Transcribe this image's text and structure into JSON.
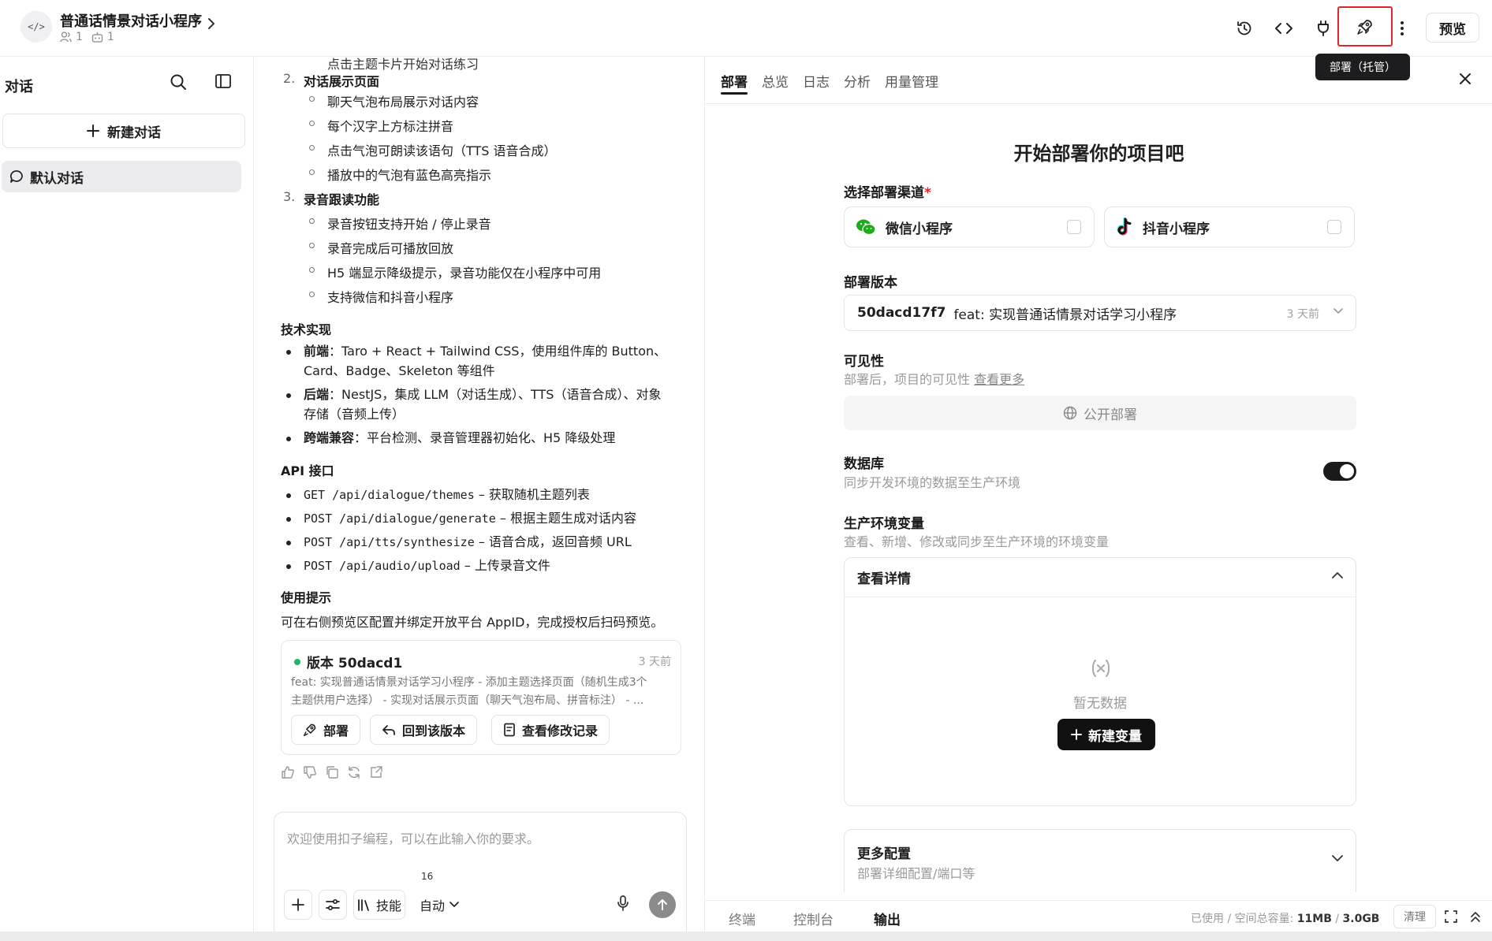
{
  "topbar": {
    "project_icon_text": "</>",
    "project_title": "普通话情景对话小程序",
    "members": "1",
    "bots": "1",
    "deploy_tooltip": "部署（托管）",
    "preview_label": "预览"
  },
  "sidebar": {
    "title": "对话",
    "new_chat_label": "新建对话",
    "items": [
      {
        "label": "默认对话"
      }
    ]
  },
  "chat": {
    "clipped_text": "点击主题卡片开始对话练习",
    "sections": [
      {
        "num": "2.",
        "title": "对话展示页面",
        "items": [
          "聊天气泡布局展示对话内容",
          "每个汉字上方标注拼音",
          "点击气泡可朗读该语句（TTS 语音合成）",
          "播放中的气泡有蓝色高亮指示"
        ]
      },
      {
        "num": "3.",
        "title": "录音跟读功能",
        "items": [
          "录音按钮支持开始 / 停止录音",
          "录音完成后可播放回放",
          "H5 端显示降级提示，录音功能仅在小程序中可用",
          "支持微信和抖音小程序"
        ]
      }
    ],
    "tech_heading": "技术实现",
    "tech": [
      {
        "label": "前端",
        "line1": "：Taro + React + Tailwind CSS，使用组件库的 Button、",
        "line2": "Card、Badge、Skeleton 等组件"
      },
      {
        "label": "后端",
        "line1": "：NestJS，集成 LLM（对话生成）、TTS（语音合成）、对象",
        "line2": "存储（音频上传）"
      },
      {
        "label": "跨端兼容",
        "line1": "：平台检测、录音管理器初始化、H5 降级处理",
        "line2": ""
      }
    ],
    "api_heading": "API 接口",
    "apis": [
      {
        "code": "GET /api/dialogue/themes",
        "desc": " – 获取随机主题列表"
      },
      {
        "code": "POST /api/dialogue/generate",
        "desc": " – 根据主题生成对话内容"
      },
      {
        "code": "POST /api/tts/synthesize",
        "desc": " – 语音合成，返回音频 URL"
      },
      {
        "code": "POST /api/audio/upload",
        "desc": " – 上传录音文件"
      }
    ],
    "tips_heading": "使用提示",
    "tips_text": "可在右侧预览区配置并绑定开放平台 AppID，完成授权后扫码预览。",
    "version_card": {
      "title": "版本 50dacd1",
      "time": "3 天前",
      "desc_line1": "feat: 实现普通话情景对话学习小程序 - 添加主题选择页面（随机生成3个",
      "desc_line2": "主题供用户选择） - 实现对话展示页面（聊天气泡布局、拼音标注） - ...",
      "deploy_label": "部署",
      "revert_label": "回到该版本",
      "changes_label": "查看修改记录"
    },
    "input": {
      "placeholder": "欢迎使用扣子编程，可以在此输入你的要求。",
      "skill_label": "技能",
      "skill_count": "16",
      "mode_label": "自动"
    }
  },
  "right": {
    "tabs": [
      "部署",
      "总览",
      "日志",
      "分析",
      "用量管理"
    ],
    "title": "开始部署你的项目吧",
    "channel_label": "选择部署渠道",
    "channels": [
      "微信小程序",
      "抖音小程序"
    ],
    "version_label": "部署版本",
    "version_hash": "50dacd17f7",
    "version_msg": "feat: 实现普通话情景对话学习小程序",
    "version_time": "3 天前",
    "visibility_label": "可见性",
    "visibility_sub": "部署后，项目的可见性",
    "see_more": "查看更多",
    "public_label": "公开部署",
    "db_label": "数据库",
    "db_sub": "同步开发环境的数据至生产环境",
    "env_label": "生产环境变量",
    "env_sub": "查看、新增、修改或同步至生产环境的环境变量",
    "env_details": "查看详情",
    "empty_text": "暂无数据",
    "new_var_label": "新建变量",
    "more_title": "更多配置",
    "more_sub": "部署详细配置/端口等",
    "bottom_tabs": [
      "终端",
      "控制台",
      "输出"
    ],
    "storage_prefix": "已使用 / 空间总容量: ",
    "storage_used": "11MB",
    "storage_sep": " / ",
    "storage_total": "3.0GB",
    "clean_label": "清理"
  }
}
